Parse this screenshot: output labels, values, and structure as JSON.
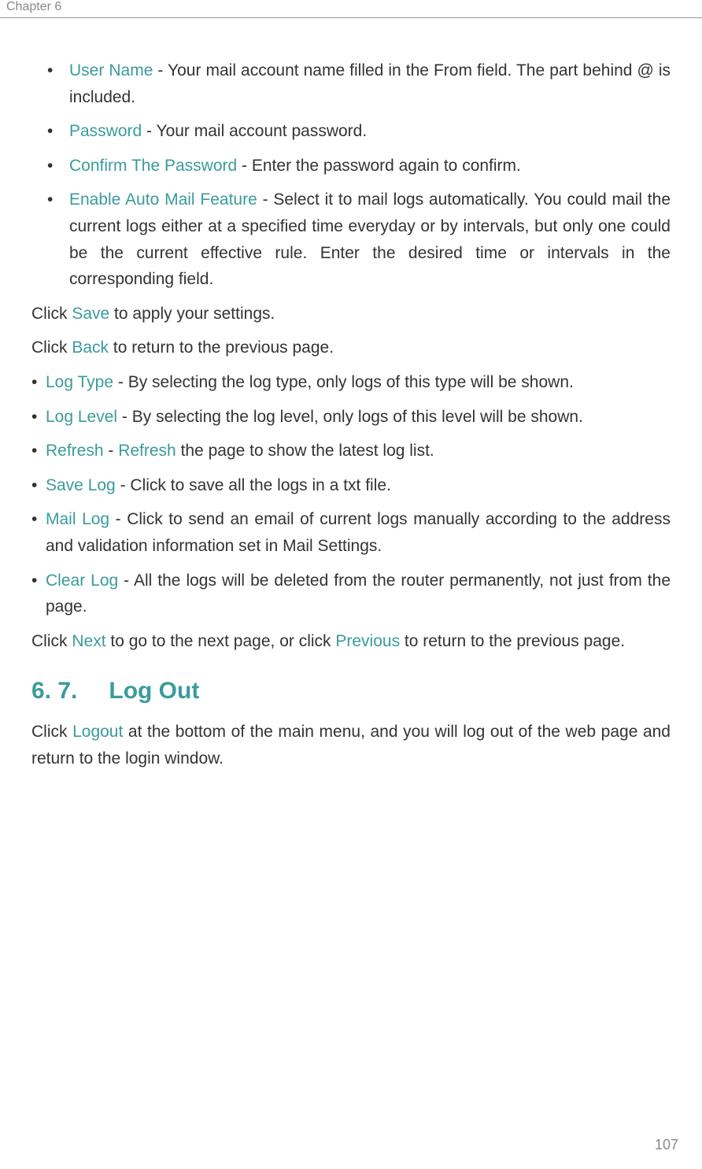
{
  "header": {
    "chapter": "Chapter 6"
  },
  "list1": {
    "item1": {
      "term": "User Name",
      "text": " - Your mail account name filled in the From field. The part behind @ is included."
    },
    "item2": {
      "term": "Password",
      "text": " - Your mail account password."
    },
    "item3": {
      "term": "Confirm The Password",
      "text": " - Enter the password again to confirm."
    },
    "item4": {
      "term": "Enable Auto Mail Feature",
      "text": " - Select it to mail logs automatically. You could mail the current logs either at a specified time everyday or by intervals, but only one could be the current effective rule. Enter the desired time or intervals in the corresponding field."
    }
  },
  "para1": {
    "prefix": "Click ",
    "term": "Save",
    "suffix": " to apply your settings."
  },
  "para2": {
    "prefix": "Click ",
    "term": "Back",
    "suffix": " to return to the previous page."
  },
  "list2": {
    "item1": {
      "term": "Log Type",
      "text": " - By selecting the log type, only logs of this type will be shown."
    },
    "item2": {
      "term": "Log Level",
      "text": " - By selecting the log level, only logs of this level will be shown."
    },
    "item3": {
      "term1": "Refresh",
      "mid": " - ",
      "term2": "Refresh",
      "text": " the page to show the latest log list."
    },
    "item4": {
      "term": "Save Log",
      "text": " - Click to save all the logs in a txt file."
    },
    "item5": {
      "term": "Mail Log",
      "text": " - Click to send an email of current logs manually according to the address and validation information set in Mail Settings."
    },
    "item6": {
      "term": "Clear Log",
      "text": " - All the logs will be deleted from the router permanently, not just from the page."
    }
  },
  "para3": {
    "prefix": "Click ",
    "term1": "Next",
    "mid": " to go to the next page, or click ",
    "term2": "Previous",
    "suffix": " to return to the previous page."
  },
  "section": {
    "number": "6. 7.",
    "title": "Log Out"
  },
  "para4": {
    "prefix": "Click ",
    "term": "Logout",
    "suffix": " at the bottom of the main menu, and you will log out of the web page and return to the login window."
  },
  "pageNumber": "107"
}
